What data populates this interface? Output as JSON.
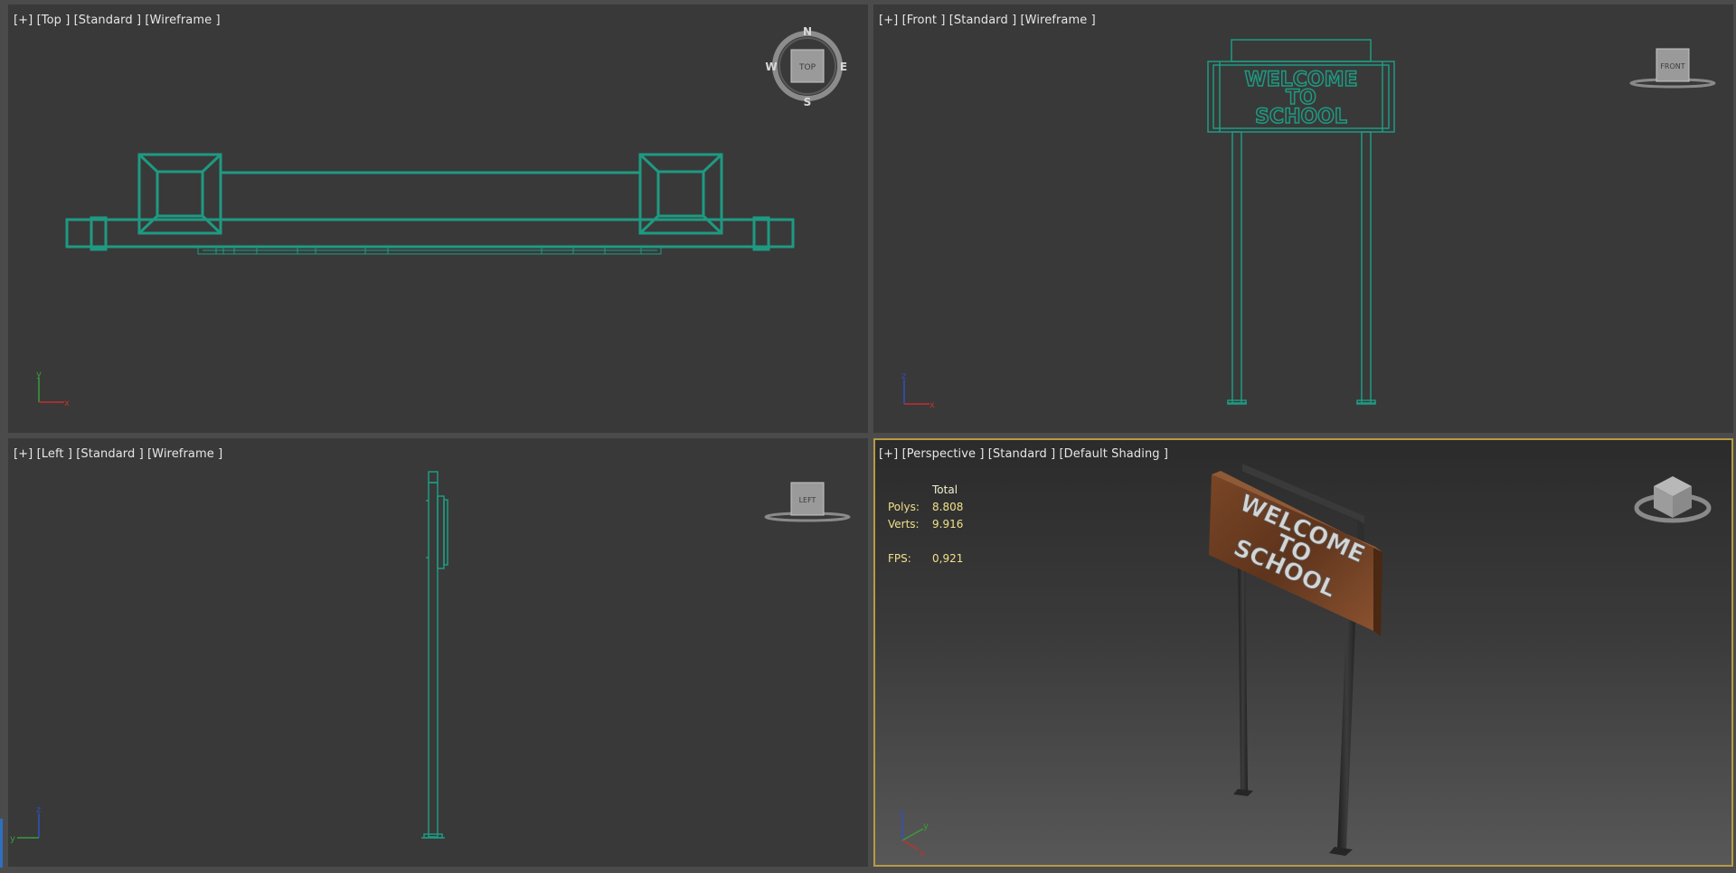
{
  "viewports": {
    "top": {
      "label": "[+] [Top ] [Standard ] [Wireframe ]",
      "cube_label": "TOP"
    },
    "front": {
      "label": "[+] [Front ] [Standard ] [Wireframe ]",
      "cube_label": "FRONT"
    },
    "left": {
      "label": "[+] [Left ] [Standard ] [Wireframe ]",
      "cube_label": "LEFT"
    },
    "perspective": {
      "label": "[+] [Perspective ] [Standard ] [Default Shading ]",
      "stats": {
        "header": "Total",
        "polys_label": "Polys:",
        "polys_value": "8.808",
        "verts_label": "Verts:",
        "verts_value": "9.916",
        "fps_label": "FPS:",
        "fps_value": "0,921"
      }
    }
  },
  "compass": {
    "n": "N",
    "s": "S",
    "e": "E",
    "w": "W"
  },
  "axes": {
    "x": "x",
    "y": "y",
    "z": "z"
  },
  "sign": {
    "line1": "WELCOME",
    "line2": "TO",
    "line3": "SCHOOL"
  },
  "colors": {
    "wireframe": "#1e9a82",
    "active_border": "#b69b45",
    "stats_text": "#f0e08a",
    "wood": "#6b3e22"
  }
}
